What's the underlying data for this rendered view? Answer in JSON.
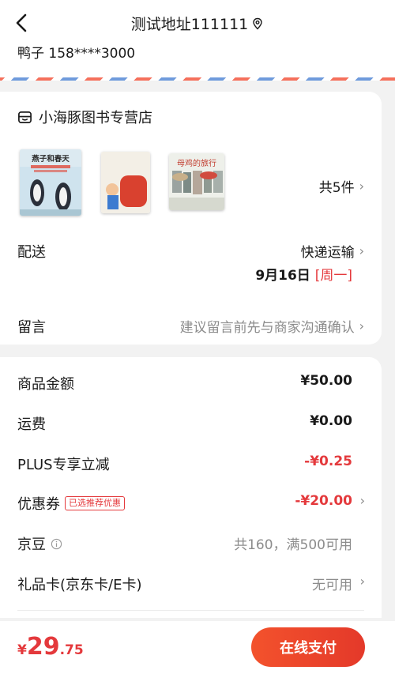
{
  "header": {
    "title": "测试地址111111"
  },
  "address": {
    "line": "鸭子 158****3000"
  },
  "store": {
    "name": "小海豚图书专营店",
    "books": [
      {
        "title": "燕子和春天"
      },
      {
        "title": ""
      },
      {
        "title": "母鸡的旅行"
      }
    ],
    "item_count": "共5件",
    "delivery_label": "配送",
    "delivery_method": "快递运输",
    "delivery_date": "9月16日",
    "delivery_weekday": "[周一]",
    "remark_label": "留言",
    "remark_hint": "建议留言前先与商家沟通确认"
  },
  "summary": {
    "goods_label": "商品金额",
    "goods_value": "¥50.00",
    "shipping_label": "运费",
    "shipping_value": "¥0.00",
    "plus_label": "PLUS专享立减",
    "plus_value": "-¥0.25",
    "coupon_label": "优惠券",
    "coupon_tag": "已选推荐优惠",
    "coupon_value": "-¥20.00",
    "jingdou_label": "京豆",
    "jingdou_value": "共160，满500可用",
    "giftcard_label": "礼品卡(京东卡/E卡)",
    "giftcard_value": "无可用"
  },
  "footer": {
    "currency": "¥",
    "total_int": "29",
    "total_dec": ".75",
    "pay_label": "在线支付"
  },
  "colors": {
    "accent": "#e4393c",
    "pay_gradient_start": "#f3522c",
    "muted": "#8c8c8c"
  }
}
